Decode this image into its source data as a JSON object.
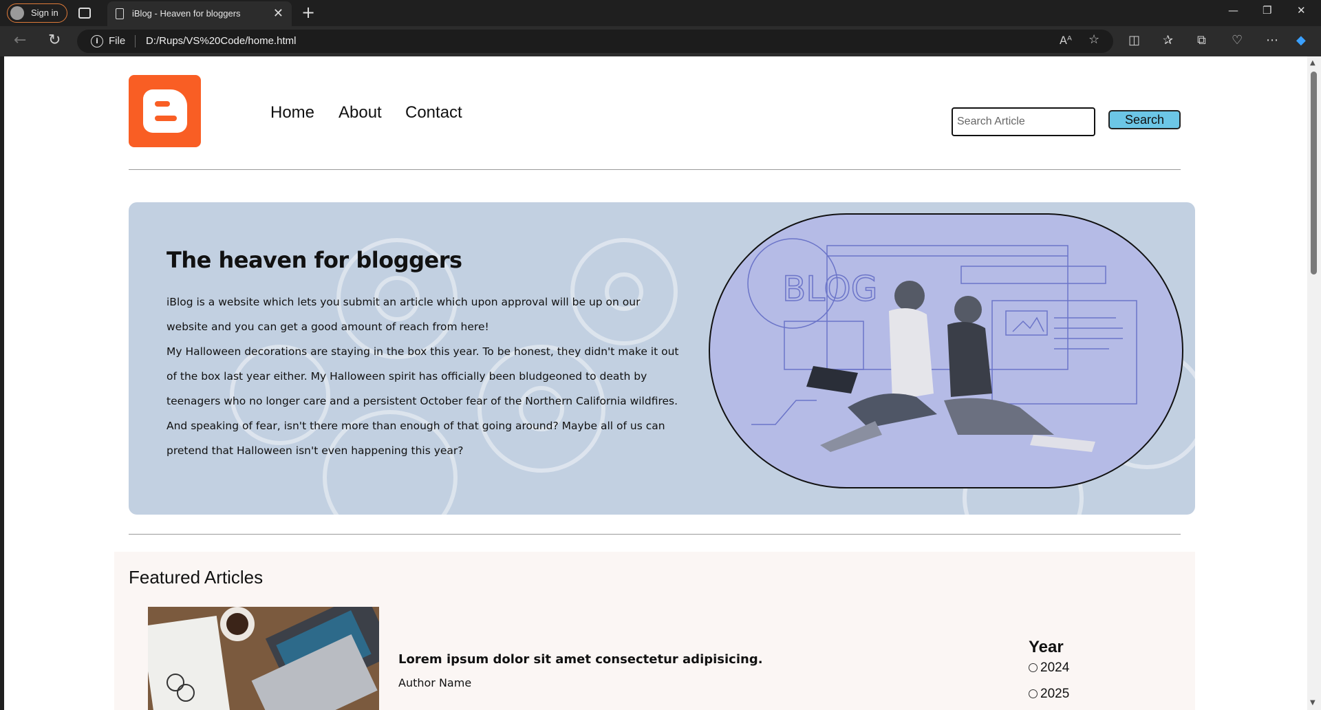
{
  "browser": {
    "signin_label": "Sign in",
    "tab_title": "iBlog - Heaven for bloggers",
    "address_scheme": "File",
    "url": "D:/Rups/VS%20Code/home.html"
  },
  "header": {
    "nav": [
      "Home",
      "About",
      "Contact"
    ],
    "search_placeholder": "Search Article",
    "search_button": "Search"
  },
  "hero": {
    "title": "The heaven for bloggers",
    "paragraph1": "iBlog is a website which lets you submit an article which upon approval will be up on our website and you can get a good amount of reach from here!",
    "paragraph2": "My Halloween decorations are staying in the box this year. To be honest, they didn't make it out of the box last year either. My Halloween spirit has officially been bludgeoned to death by teenagers who no longer care and a persistent October fear of the Northern California wildfires. And speaking of fear, isn't there more than enough of that going around? Maybe all of us can pretend that Halloween isn't even happening this year?",
    "image_text": "BLOG"
  },
  "featured": {
    "heading": "Featured Articles",
    "article_title": "Lorem ipsum dolor sit amet consectetur adipisicing.",
    "article_author": "Author Name",
    "year_heading": "Year",
    "years": [
      "2024",
      "2025"
    ]
  },
  "colors": {
    "logo": "#f95e24",
    "hero_bg": "#c2d0e1",
    "oval_bg": "#b5bbe6",
    "search_button": "#6cc6e6",
    "featured_bg": "#fbf6f4"
  }
}
